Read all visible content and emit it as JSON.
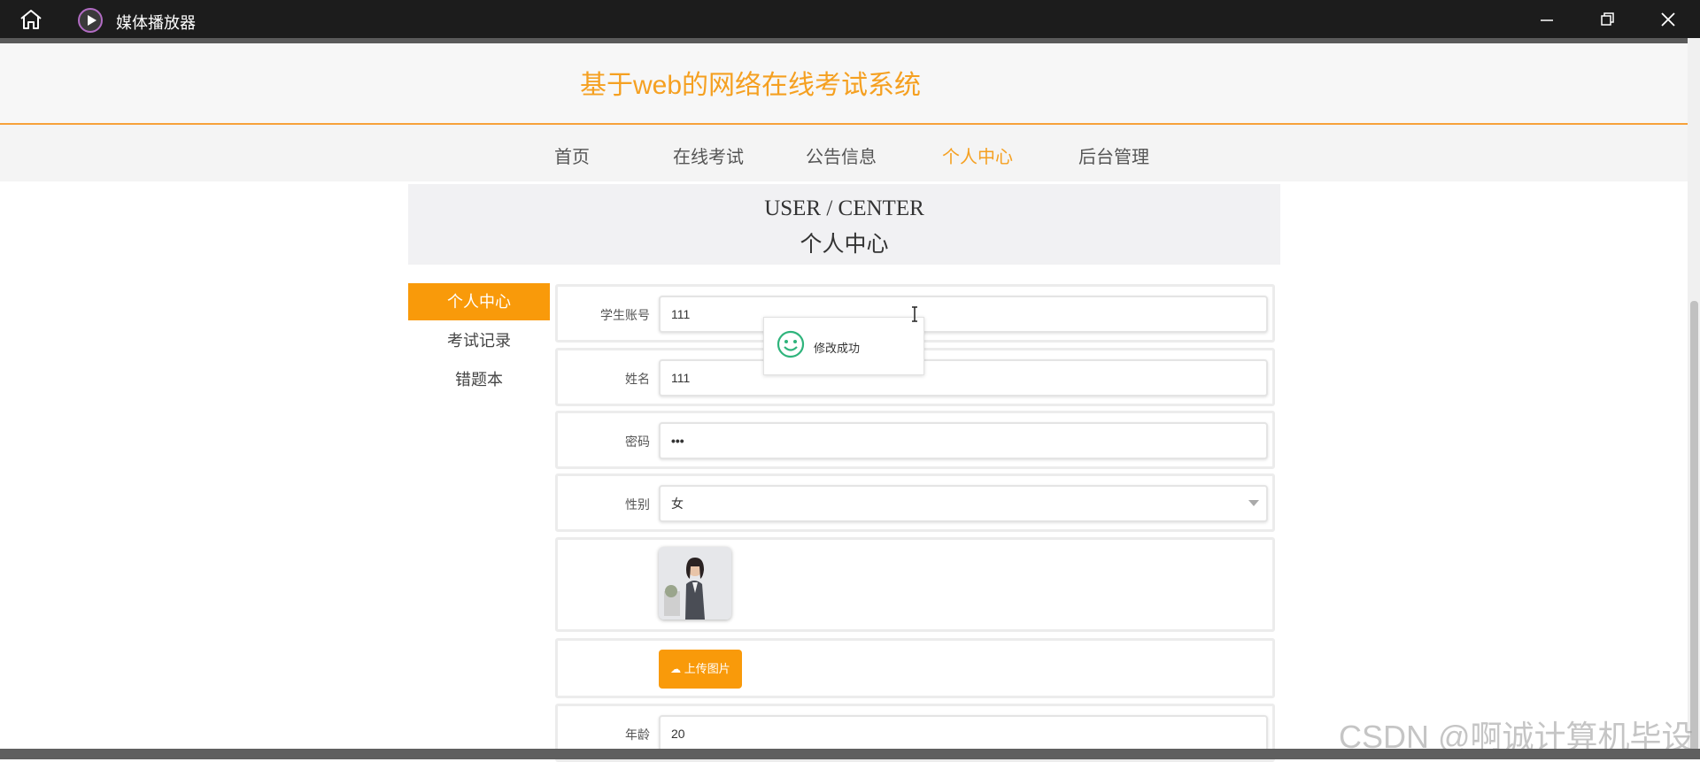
{
  "window": {
    "title": "媒体播放器"
  },
  "site": {
    "title": "基于web的网络在线考试系统"
  },
  "nav": {
    "items": [
      {
        "label": "首页"
      },
      {
        "label": "在线考试"
      },
      {
        "label": "公告信息"
      },
      {
        "label": "个人中心",
        "active": true
      },
      {
        "label": "后台管理"
      }
    ]
  },
  "banner": {
    "en": "USER / CENTER",
    "cn": "个人中心"
  },
  "side_menu": {
    "items": [
      {
        "label": "个人中心",
        "active": true
      },
      {
        "label": "考试记录"
      },
      {
        "label": "错题本"
      }
    ]
  },
  "form": {
    "account_label": "学生账号",
    "account_value": "111",
    "name_label": "姓名",
    "name_value": "111",
    "password_label": "密码",
    "password_value": "•••",
    "gender_label": "性别",
    "gender_value": "女",
    "upload_label": "上传图片",
    "age_label": "年龄",
    "age_value": "20"
  },
  "toast": {
    "message": "修改成功"
  },
  "watermark": "CSDN @啊诚计算机毕设",
  "colors": {
    "accent": "#f5a021",
    "accent_button": "#f99a0a"
  }
}
